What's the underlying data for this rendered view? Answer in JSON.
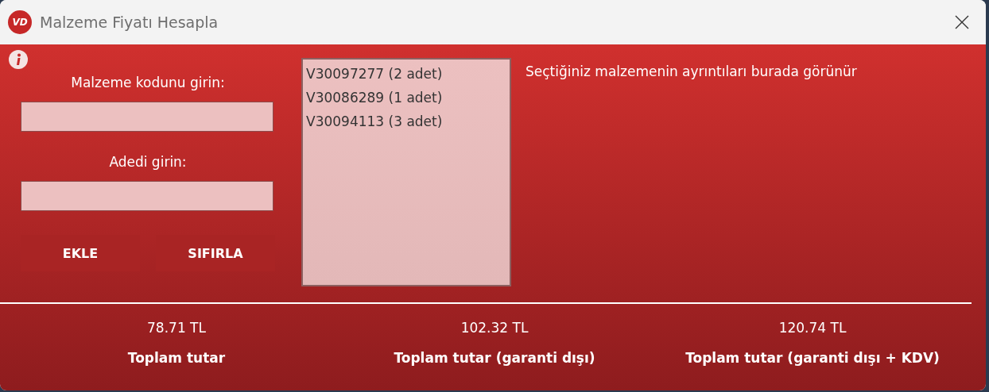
{
  "window": {
    "title": "Malzeme Fiyatı Hesapla",
    "logo_text": "VD"
  },
  "form": {
    "code_label": "Malzeme kodunu girin:",
    "quantity_label": "Adedi girin:",
    "buttons": [
      "EKLE",
      "SIFIRLA"
    ]
  },
  "list": {
    "items": [
      "V30097277 (2 adet)",
      "V30086289 (1 adet)",
      "V30094113 (3 adet)"
    ]
  },
  "details": "Seçtiğiniz malzemenin ayrıntıları burada görünür",
  "totals": [
    {
      "value": "78.71 TL",
      "label": "Toplam tutar"
    },
    {
      "value": "102.32 TL",
      "label": "Toplam tutar (garanti dışı)"
    },
    {
      "value": "120.74 TL",
      "label": "Toplam tutar (garanti dışı + KDV)"
    }
  ]
}
